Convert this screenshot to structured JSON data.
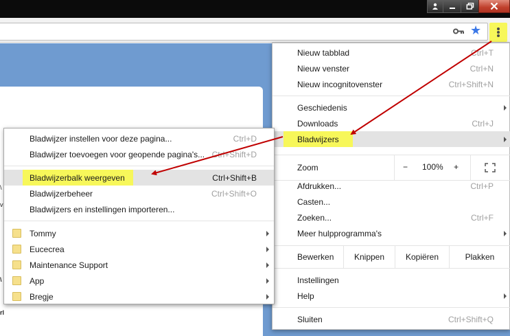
{
  "colors": {
    "highlight": "#f7f75a",
    "arrow": "#c00000",
    "star": "#3b78e7",
    "close": "#c0402c"
  },
  "icons": {
    "user": "user-icon",
    "minimize": "minimize-icon",
    "restore": "restore-icon",
    "close": "close-icon",
    "key": "key-icon",
    "star": "star-icon",
    "menu": "vertical-dots-icon",
    "fullscreen": "fullscreen-icon",
    "folder": "folder-icon"
  },
  "toolbar": {
    "star_glyph": "★"
  },
  "main_menu": {
    "new_tab": {
      "label": "Nieuw tabblad",
      "shortcut": "Ctrl+T"
    },
    "new_window": {
      "label": "Nieuw venster",
      "shortcut": "Ctrl+N"
    },
    "new_incognito": {
      "label": "Nieuw incognitovenster",
      "shortcut": "Ctrl+Shift+N"
    },
    "history": {
      "label": "Geschiedenis"
    },
    "downloads": {
      "label": "Downloads",
      "shortcut": "Ctrl+J"
    },
    "bookmarks": {
      "label": "Bladwijzers"
    },
    "zoom": {
      "label": "Zoom",
      "minus": "−",
      "value": "100%",
      "plus": "+"
    },
    "print": {
      "label": "Afdrukken...",
      "shortcut": "Ctrl+P"
    },
    "cast": {
      "label": "Casten..."
    },
    "find": {
      "label": "Zoeken...",
      "shortcut": "Ctrl+F"
    },
    "more_tools": {
      "label": "Meer hulpprogramma's"
    },
    "edit": {
      "label": "Bewerken",
      "cut": "Knippen",
      "copy": "Kopiëren",
      "paste": "Plakken"
    },
    "settings": {
      "label": "Instellingen"
    },
    "help": {
      "label": "Help"
    },
    "exit": {
      "label": "Sluiten",
      "shortcut": "Ctrl+Shift+Q"
    }
  },
  "bookmarks_menu": {
    "bookmark_page": {
      "label": "Bladwijzer instellen voor deze pagina...",
      "shortcut": "Ctrl+D"
    },
    "bookmark_open_pages": {
      "label": "Bladwijzer toevoegen voor geopende pagina's...",
      "shortcut": "Ctrl+Shift+D"
    },
    "show_bar": {
      "label": "Bladwijzerbalk weergeven",
      "shortcut": "Ctrl+Shift+B"
    },
    "manager": {
      "label": "Bladwijzerbeheer",
      "shortcut": "Ctrl+Shift+O"
    },
    "import": {
      "label": "Bladwijzers en instellingen importeren..."
    },
    "folders": [
      "Tommy",
      "Eucecrea",
      "Maintenance Support",
      "App",
      "Bregje"
    ]
  }
}
